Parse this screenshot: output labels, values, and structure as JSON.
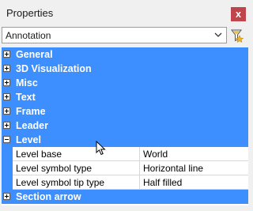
{
  "panel": {
    "title": "Properties",
    "close_glyph": "x",
    "selector_value": "Annotation",
    "filter_icon": "quick-select-filter-icon"
  },
  "categories_top": [
    {
      "label": "General",
      "state": "collapsed"
    },
    {
      "label": "3D Visualization",
      "state": "collapsed"
    },
    {
      "label": "Misc",
      "state": "collapsed"
    },
    {
      "label": "Text",
      "state": "collapsed"
    },
    {
      "label": "Frame",
      "state": "collapsed"
    },
    {
      "label": "Leader",
      "state": "collapsed"
    },
    {
      "label": "Level",
      "state": "expanded"
    }
  ],
  "level_properties": [
    {
      "name": "Level base",
      "value": "World"
    },
    {
      "name": "Level symbol type",
      "value": "Horizontal line"
    },
    {
      "name": "Level symbol tip type",
      "value": "Half filled"
    }
  ],
  "categories_bottom": [
    {
      "label": "Section arrow",
      "state": "collapsed"
    }
  ],
  "colors": {
    "category_bg": "#3d8fff",
    "close_bg": "#c0444c"
  }
}
